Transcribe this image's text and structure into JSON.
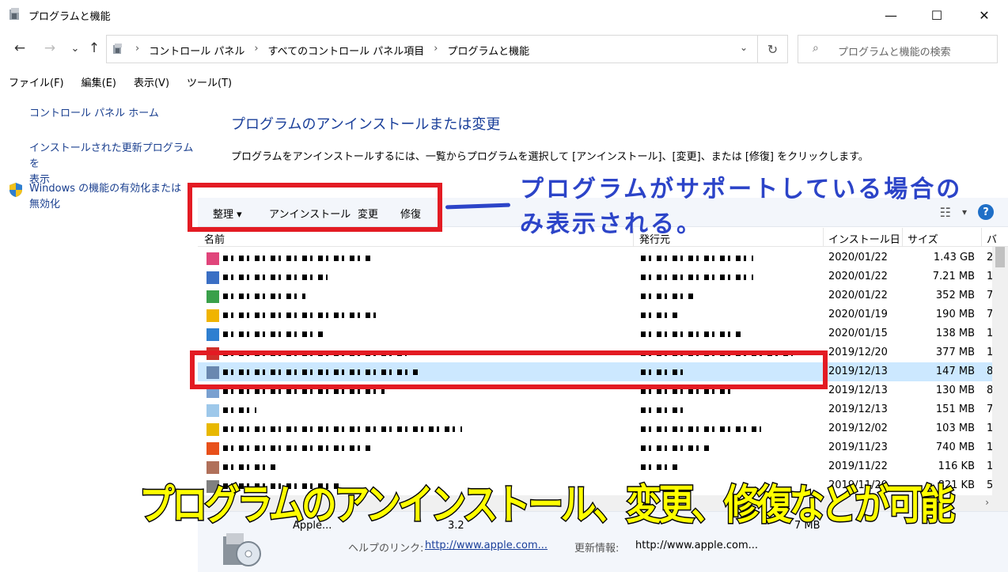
{
  "window": {
    "title": "プログラムと機能",
    "minimize": "—",
    "maximize": "☐",
    "close": "✕"
  },
  "nav": {
    "back": "←",
    "forward": "→",
    "recent": "⌄",
    "up": "↑",
    "breadcrumb": [
      "コントロール パネル",
      "すべてのコントロール パネル項目",
      "プログラムと機能"
    ],
    "dropdown": "⌄",
    "refresh": "↻",
    "search_placeholder": "プログラムと機能の検索"
  },
  "menu": {
    "file": "ファイル(F)",
    "edit": "編集(E)",
    "view": "表示(V)",
    "tools": "ツール(T)"
  },
  "sidebar": {
    "home": "コントロール パネル ホーム",
    "updates_line1": "インストールされた更新プログラムを",
    "updates_line2": "表示",
    "features_line1": "Windows の機能の有効化または",
    "features_line2": "無効化"
  },
  "main": {
    "heading": "プログラムのアンインストールまたは変更",
    "description": "プログラムをアンインストールするには、一覧からプログラムを選択して [アンインストール]、[変更]、または [修復] をクリックします。"
  },
  "toolbar": {
    "organize": "整理 ▾",
    "uninstall": "アンインストール",
    "change": "変更",
    "repair": "修復",
    "view_icon": "☷",
    "view_dd": "▾",
    "help": "?"
  },
  "columns": {
    "name": "名前",
    "publisher": "発行元",
    "installed": "インストール日",
    "size": "サイズ",
    "version": "バ"
  },
  "rows": [
    {
      "date": "2020/01/22",
      "size": "1.43 GB",
      "extra": "2",
      "color": "#e0457b"
    },
    {
      "date": "2020/01/22",
      "size": "7.21 MB",
      "extra": "1",
      "color": "#3a6fc4"
    },
    {
      "date": "2020/01/22",
      "size": "352 MB",
      "extra": "7",
      "color": "#3aa04a"
    },
    {
      "date": "2020/01/19",
      "size": "190 MB",
      "extra": "7",
      "color": "#f0b400"
    },
    {
      "date": "2020/01/15",
      "size": "138 MB",
      "extra": "1",
      "color": "#2f7fd0"
    },
    {
      "date": "2019/12/20",
      "size": "377 MB",
      "extra": "1",
      "color": "#d0302a"
    },
    {
      "date": "2019/12/13",
      "size": "147 MB",
      "extra": "8",
      "color": "#6a88b0"
    },
    {
      "date": "2019/12/13",
      "size": "130 MB",
      "extra": "8",
      "color": "#7aa0d0"
    },
    {
      "date": "2019/12/13",
      "size": "151 MB",
      "extra": "7",
      "color": "#9ec8ea"
    },
    {
      "date": "2019/12/02",
      "size": "103 MB",
      "extra": "1",
      "color": "#e8b800"
    },
    {
      "date": "2019/11/23",
      "size": "740 MB",
      "extra": "1",
      "color": "#e8501a"
    },
    {
      "date": "2019/11/22",
      "size": "116 KB",
      "extra": "1",
      "color": "#b0705a"
    },
    {
      "date": "2019/11/20",
      "size": "821 KB",
      "extra": "5",
      "color": "#808080"
    }
  ],
  "details": {
    "publisher_name": "Apple...",
    "version_fragment": "3.2",
    "size_fragment": "7 MB",
    "help_label": "ヘルプのリンク:",
    "help_link": "http://www.apple.com...",
    "update_label": "更新情報:",
    "update_link": "http://www.apple.com..."
  },
  "annotations": {
    "blue_note": "プログラムがサポートしている場合のみ表示される。",
    "yellow_caption": "プログラムのアンインストール、変更、修復などが可能"
  },
  "colors": {
    "accent_blue": "#1a3f9a",
    "annotation_red": "#e31b23",
    "annotation_blue": "#2c44c8",
    "caption_yellow": "#ffff00",
    "selection": "#cce8ff"
  }
}
